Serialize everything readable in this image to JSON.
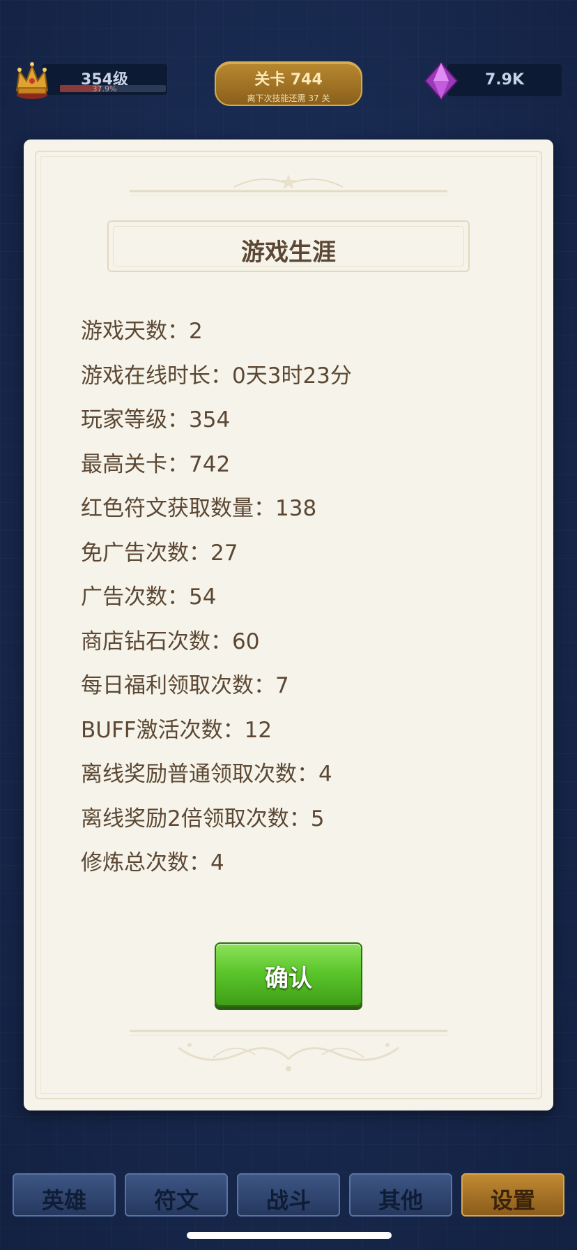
{
  "hud": {
    "level_text": "354级",
    "level_progress_text": "37.9%",
    "level_progress": 0.379,
    "stage_title": "关卡 744",
    "stage_subtitle": "离下次技能还需 37 关",
    "gems_value": "7.9K"
  },
  "modal": {
    "title": "游戏生涯",
    "stats": [
      "游戏天数：2",
      "游戏在线时长：0天3时23分",
      "玩家等级：354",
      "最高关卡：742",
      "红色符文获取数量：138",
      "免广告次数：27",
      "广告次数：54",
      "商店钻石次数：60",
      "每日福利领取次数：7",
      "BUFF激活次数：12",
      "离线奖励普通领取次数：4",
      "离线奖励2倍领取次数：5",
      "修炼总次数：4"
    ],
    "confirm_label": "确认"
  },
  "nav": {
    "tabs": [
      "英雄",
      "符文",
      "战斗",
      "其他",
      "设置"
    ],
    "active": "设置"
  },
  "colors": {
    "background": "#17294f",
    "panel": "#f6f4ea",
    "text": "#5b4733",
    "confirm_green": "#5cc62c",
    "active_tab": "#c08932"
  }
}
